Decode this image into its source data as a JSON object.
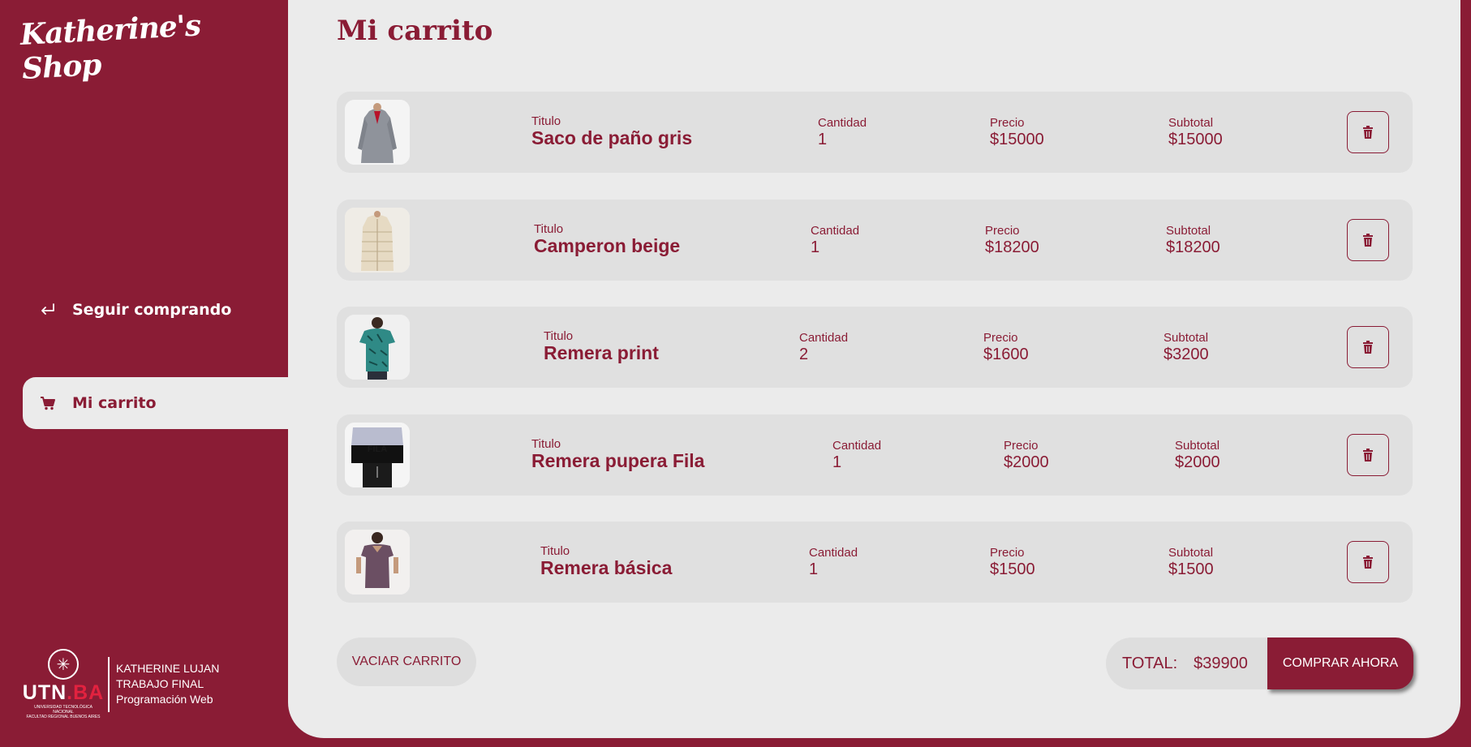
{
  "brand": {
    "logo_text": "Katherine's Shop"
  },
  "sidebar": {
    "items": [
      {
        "label": "Seguir comprando",
        "icon": "return-arrow-icon"
      },
      {
        "label": "Mi carrito",
        "icon": "cart-icon",
        "active": true
      }
    ]
  },
  "footer": {
    "utn_logo_text": "UTN",
    "utn_logo_suffix": ".BA",
    "utn_small_line1": "UNIVERSIDAD TECNOLÓGICA NACIONAL",
    "utn_small_line2": "FACULTAD REGIONAL BUENOS AIRES",
    "author": "KATHERINE LUJAN",
    "project": "TRABAJO FINAL",
    "course": "Programación Web"
  },
  "main": {
    "title": "Mi carrito",
    "labels": {
      "title": "Titulo",
      "quantity": "Cantidad",
      "price": "Precio",
      "subtotal": "Subtotal"
    },
    "items": [
      {
        "title": "Saco de paño gris",
        "quantity": "1",
        "price": "$15000",
        "subtotal": "$15000"
      },
      {
        "title": "Camperon beige",
        "quantity": "1",
        "price": "$18200",
        "subtotal": "$18200"
      },
      {
        "title": "Remera print",
        "quantity": "2",
        "price": "$1600",
        "subtotal": "$3200"
      },
      {
        "title": "Remera pupera Fila",
        "quantity": "1",
        "price": "$2000",
        "subtotal": "$2000"
      },
      {
        "title": "Remera básica",
        "quantity": "1",
        "price": "$1500",
        "subtotal": "$1500"
      }
    ],
    "empty_cart_label": "VACIAR CARRITO",
    "total_label": "TOTAL:",
    "total_value": "$39900",
    "buy_label": "COMPRAR AHORA"
  },
  "colors": {
    "brand": "#8a1c35",
    "background": "#ebebeb",
    "row": "#e0e0e0"
  }
}
